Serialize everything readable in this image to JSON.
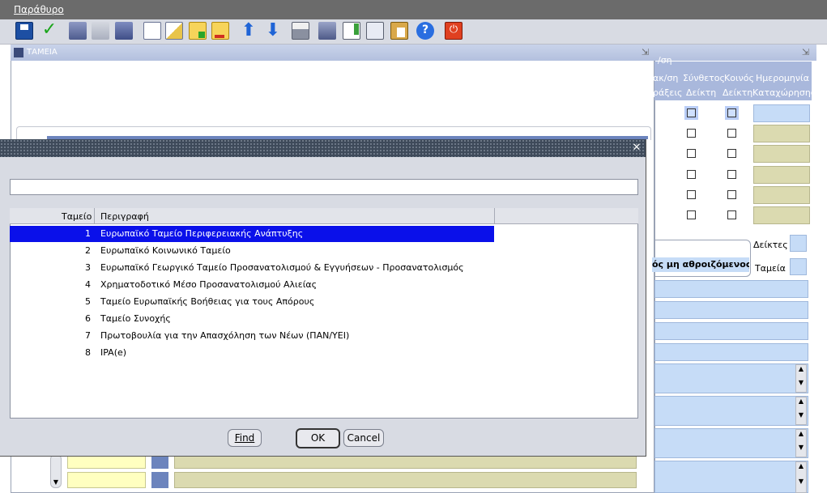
{
  "menubar": {
    "title": "Παράθυρο"
  },
  "colors": {
    "selection": "#0a10ea",
    "toolbar_bg": "#d8dbe3",
    "header_blue": "#a9b8dc",
    "tan_field": "#dbdab0",
    "yellow_field": "#ffffc0"
  },
  "toolbar": {
    "icons": [
      "save-icon",
      "check-icon",
      "form-icon",
      "clear-icon",
      "refresh-icon",
      "document-icon",
      "edit-icon",
      "insert-record-icon",
      "delete-record-icon",
      "arrow-up-icon",
      "arrow-down-icon",
      "print-icon",
      "stack-icon",
      "notes-icon",
      "copy-icon",
      "paste-icon",
      "help-icon",
      "exit-icon"
    ]
  },
  "background_window": {
    "title": "ΤΑΜΕΙΑ"
  },
  "right_panel": {
    "partial_header_top": "/ση",
    "col1_line1": "ακ/ση",
    "col1_line2": "ράξεις",
    "col2_line1": "Σύνθετος",
    "col2_line2": "Δείκτη",
    "col3_line1": "Κοινός",
    "col3_line2": "Δείκτη",
    "col4_line1": "Ημερομηνία",
    "col4_line2": "Καταχώρησης",
    "combo_text": "ός μη αθροιζόμενος",
    "label_indicators": "Δείκτες",
    "label_funds": "Ταμεία"
  },
  "modal": {
    "search_value": "",
    "columns": {
      "fund": "Ταμείο",
      "description": "Περιγραφή"
    },
    "rows": [
      {
        "num": "1",
        "desc": "Ευρωπαϊκό Ταμείο Περιφερειακής Ανάπτυξης"
      },
      {
        "num": "2",
        "desc": "Ευρωπαϊκό Κοινωνικό Ταμείο"
      },
      {
        "num": "3",
        "desc": "Ευρωπαϊκό Γεωργικό Ταμείο Προσανατολισμού & Εγγυήσεων - Προσανατολισμός"
      },
      {
        "num": "4",
        "desc": "Χρηματοδοτικό Μέσο Προσανατολισμού Αλιείας"
      },
      {
        "num": "5",
        "desc": "Ταμείο Ευρωπαϊκής Βοήθειας για τους Απόρους"
      },
      {
        "num": "6",
        "desc": "Ταμείο Συνοχής"
      },
      {
        "num": "7",
        "desc": "Πρωτοβουλία για την Απασχόληση των Νέων (ΠΑΝ/ΥΕΙ)"
      },
      {
        "num": "8",
        "desc": "IPA(e)"
      }
    ],
    "buttons": {
      "find": "Find",
      "ok": "OK",
      "cancel": "Cancel"
    }
  }
}
